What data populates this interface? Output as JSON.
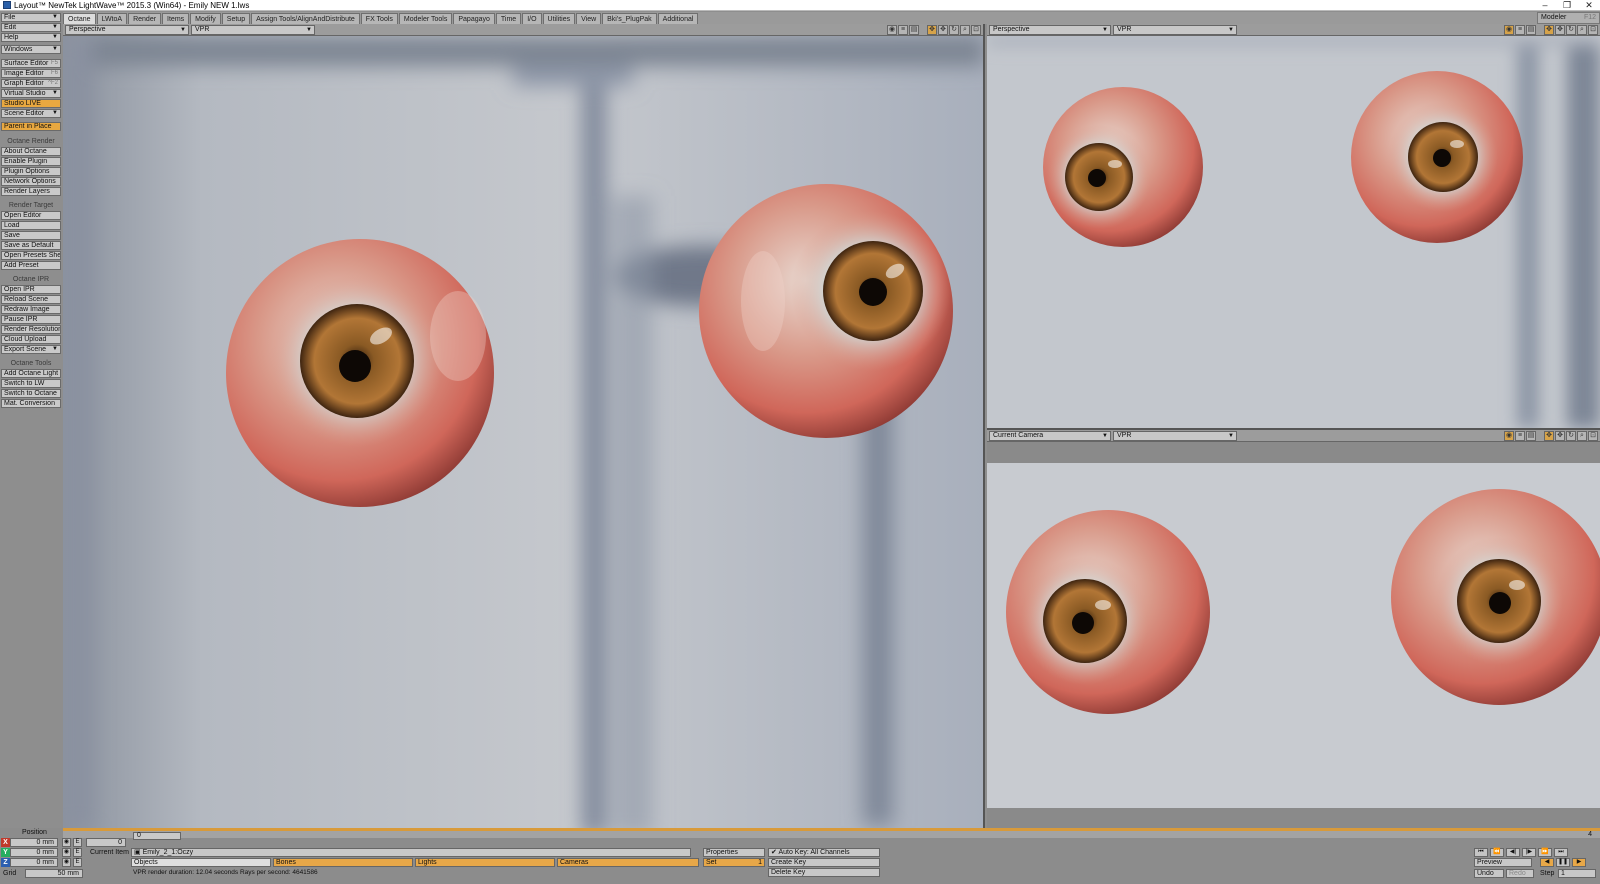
{
  "window": {
    "title": "Layout™ NewTek LightWave™ 2015.3 (Win64) - Emily NEW 1.lws",
    "controls": [
      "–",
      "❐",
      "✕"
    ]
  },
  "tabs": [
    "Octane",
    "LWtoA",
    "Render",
    "Items",
    "Modify",
    "Setup",
    "Assign Tools/AlignAndDistribute",
    "FX Tools",
    "Modeler Tools",
    "Papagayo",
    "Time",
    "I/O",
    "Utilities",
    "View",
    "Bki's_PlugPak",
    "Additional"
  ],
  "modeler": {
    "label": "Modeler",
    "shortcut": "F12"
  },
  "sidebar": {
    "menus": [
      "File",
      "Edit",
      "Help",
      "Windows"
    ],
    "editors": [
      {
        "label": "Surface Editor",
        "sc": "F5"
      },
      {
        "label": "Image Editor",
        "sc": "F6"
      },
      {
        "label": "Graph Editor",
        "sc": "^F2"
      },
      {
        "label": "Virtual Studio",
        "sc": ""
      },
      {
        "label": "Studio LIVE",
        "sc": ""
      },
      {
        "label": "Scene Editor",
        "sc": ""
      }
    ],
    "parent": "Parent in Place",
    "octane_render": {
      "header": "Octane Render",
      "items": [
        "About Octane",
        "Enable Plugin",
        "Plugin Options",
        "Network Options",
        "Render Layers"
      ]
    },
    "render_target": {
      "header": "Render Target",
      "items": [
        "Open Editor",
        "Load",
        "Save",
        "Save as Default",
        "Open Presets Shelf",
        "Add Preset"
      ]
    },
    "octane_ipr": {
      "header": "Octane IPR",
      "items": [
        "Open IPR",
        "Reload Scene",
        "Redraw Image",
        "Pause IPR",
        "Render Resolution",
        "Cloud Upload",
        "Export Scene"
      ]
    },
    "octane_tools": {
      "header": "Octane Tools",
      "items": [
        "Add Octane Light",
        "Switch to LW",
        "Switch to Octane",
        "Mat. Conversion"
      ]
    }
  },
  "viewports": {
    "main": {
      "view": "Perspective",
      "mode": "VPR"
    },
    "top_right": {
      "view": "Perspective",
      "mode": "VPR"
    },
    "bottom_right": {
      "view": "Current Camera",
      "mode": "VPR"
    }
  },
  "bottom": {
    "position_label": "Position",
    "axes": [
      {
        "axis": "X",
        "value": "0 mm",
        "color": "#c0392b"
      },
      {
        "axis": "Y",
        "value": "0 mm",
        "color": "#27ae60"
      },
      {
        "axis": "Z",
        "value": "0 mm",
        "color": "#2c5fb0"
      }
    ],
    "grid_label": "Grid",
    "grid_value": "50 mm",
    "frame_start": "0",
    "frame_current": "0",
    "frame_end": "4",
    "current_item_label": "Current Item",
    "current_item": "Emily_2_1:Oczy",
    "properties": "Properties",
    "set_label": "Set",
    "set_value": "1",
    "auto_key": "Auto Key: All Channels",
    "create_key": "Create Key",
    "delete_key": "Delete Key",
    "filters": [
      "Objects",
      "Bones",
      "Lights",
      "Cameras"
    ],
    "status": "VPR render duration: 12.04 seconds  Rays per second: 4641586",
    "preview": "Preview",
    "undo": "Undo",
    "redo": "Redo",
    "step_label": "Step",
    "step_value": "1",
    "e_label": "E"
  }
}
